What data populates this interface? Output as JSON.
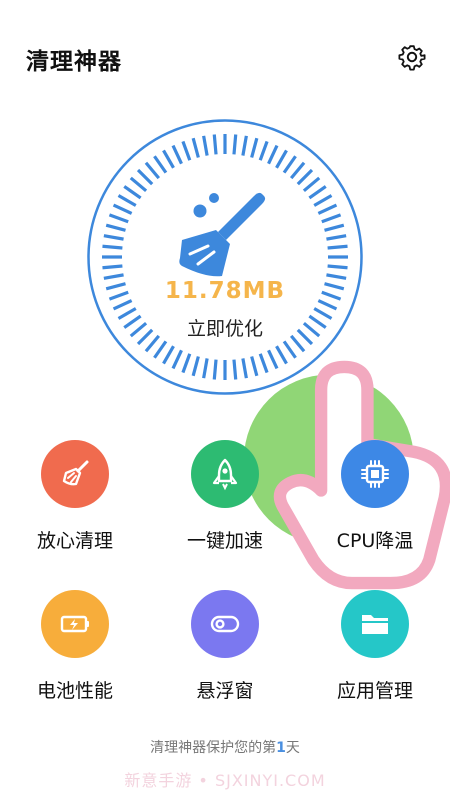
{
  "header": {
    "title": "清理神器",
    "settings_icon": "gear-icon"
  },
  "dial": {
    "size_text": "11.78MB",
    "action_label": "立即优化",
    "icon": "broom-icon",
    "ring_color": "#3d88dc",
    "size_color": "#f5b54b"
  },
  "tools": [
    {
      "label": "放心清理",
      "icon": "broom-icon",
      "color": "#f06b4e"
    },
    {
      "label": "一键加速",
      "icon": "rocket-icon",
      "color": "#2dbb72"
    },
    {
      "label": "CPU降温",
      "icon": "cpu-chip-icon",
      "color": "#3d88e6"
    },
    {
      "label": "电池性能",
      "icon": "battery-icon",
      "color": "#f7ad3b"
    },
    {
      "label": "悬浮窗",
      "icon": "floating-toggle-icon",
      "color": "#7b78f0"
    },
    {
      "label": "应用管理",
      "icon": "folder-icon",
      "color": "#25c7c8"
    }
  ],
  "footer": {
    "prefix": "清理神器保护您的第",
    "day": "1",
    "suffix": "天"
  },
  "watermark": "新意手游 • SJXINYI.COM"
}
